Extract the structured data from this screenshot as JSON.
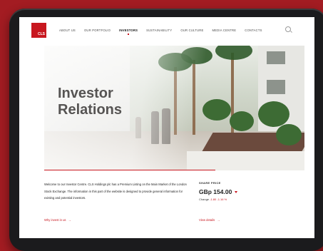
{
  "colors": {
    "brand": "#c8171f",
    "background": "#a31c22"
  },
  "logo": {
    "text": "CLS"
  },
  "nav": {
    "items": [
      {
        "label": "About us"
      },
      {
        "label": "Our portfolio"
      },
      {
        "label": "Investors"
      },
      {
        "label": "Sustainability"
      },
      {
        "label": "Our culture"
      },
      {
        "label": "Media centre"
      },
      {
        "label": "Contacts"
      }
    ],
    "active": "Investors",
    "search_icon": "search-icon"
  },
  "hero": {
    "title": "Investor\nRelations"
  },
  "intro": {
    "text": "Welcome to our Investor Centre. CLS Holdings plc has a Premium Listing on the Main Market of the London Stock Exchange. The information in this part of the website is designed to provide general information for existing and potential investors.",
    "link_label": "Why invest in us"
  },
  "share": {
    "label": "SHARE PRICE",
    "price": "GBp 154.00",
    "change_label": "Change",
    "change_value": "-1.80 -1.16 %",
    "direction_icon": "down-arrow-icon",
    "link_label": "View details"
  }
}
